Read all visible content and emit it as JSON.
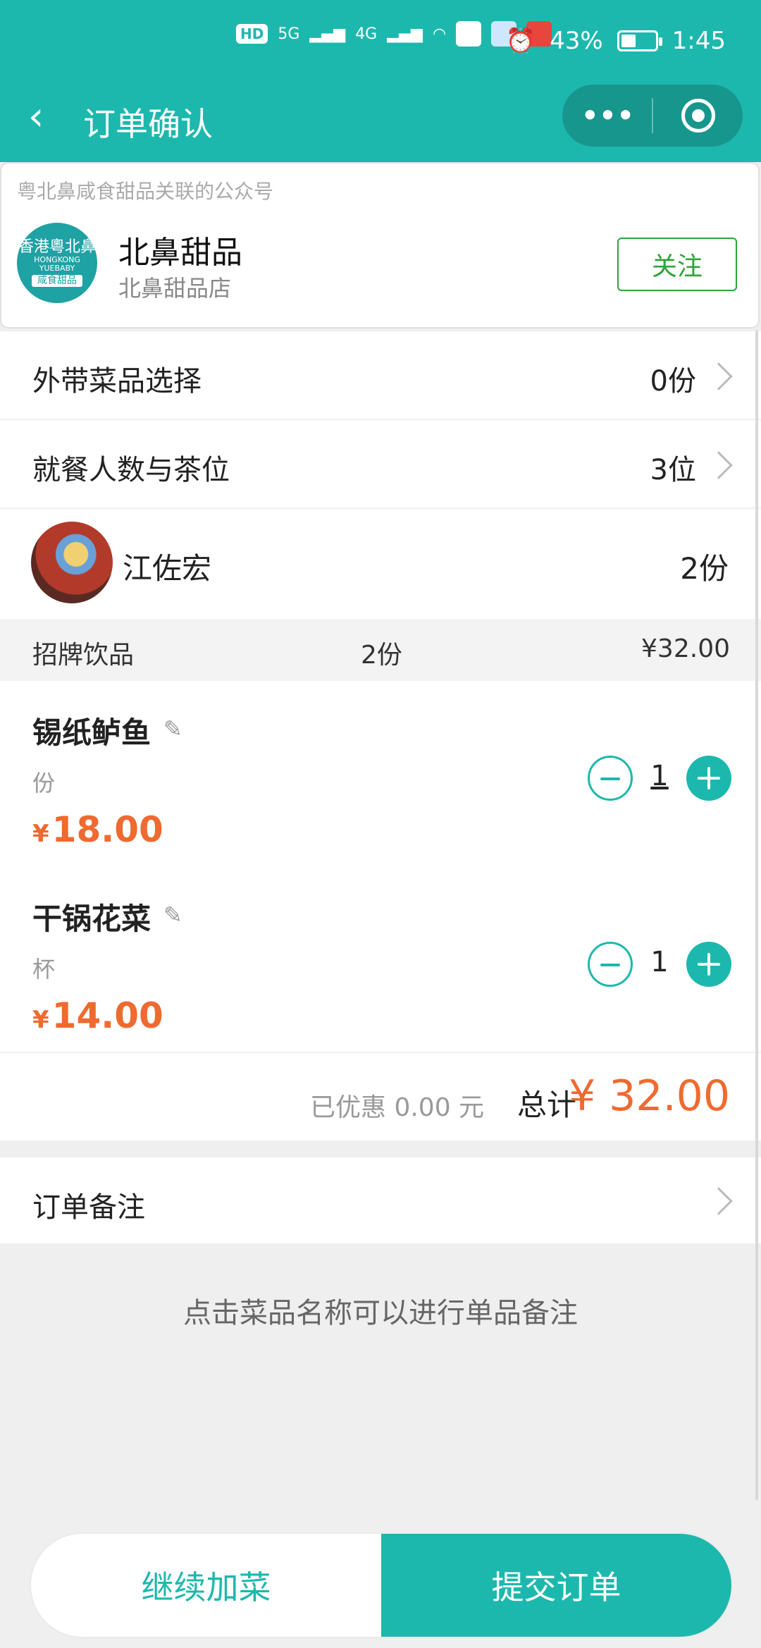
{
  "status_bar": {
    "network_badges": [
      "HD",
      "HD"
    ],
    "network_types": [
      "5G",
      "4G"
    ],
    "battery": "43%",
    "battery_level": 0.43,
    "time": "1:45"
  },
  "nav": {
    "title": "订单确认",
    "more_icon": "more-dots-icon",
    "close_icon": "target-icon"
  },
  "official_account": {
    "caption": "粤北鼻咸食甜品关联的公众号",
    "name": "北鼻甜品",
    "subtitle": "北鼻甜品店",
    "follow_label": "关注",
    "logo_text_line1": "香港粵北鼻",
    "logo_text_line2": "HONGKONG YUEBABY",
    "logo_text_line3": "咸食甜品"
  },
  "rows": {
    "takeaway_label": "外带菜品选择",
    "takeaway_value": "0份",
    "diners_label": "就餐人数与茶位",
    "diners_value": "3位"
  },
  "user": {
    "name": "江佐宏",
    "count": "2份"
  },
  "category": {
    "name": "招牌饮品",
    "qty": "2份",
    "price": "¥32.00"
  },
  "dishes": [
    {
      "name": "锡纸鲈鱼",
      "unit": "份",
      "currency": "¥",
      "price": "18.00",
      "qty": "1"
    },
    {
      "name": "干锅花菜",
      "unit": "杯",
      "currency": "¥",
      "price": "14.00",
      "qty": "1"
    }
  ],
  "summary": {
    "discount": "已优惠 0.00 元",
    "total_label": "总计",
    "total_value": "¥ 32.00"
  },
  "note": {
    "label": "订单备注"
  },
  "hint": "点击菜品名称可以进行单品备注",
  "actions": {
    "continue_label": "继续加菜",
    "submit_label": "提交订单"
  },
  "colors": {
    "accent": "#1db8ad",
    "price": "#ef6a2f",
    "follow": "#2ea43a"
  }
}
